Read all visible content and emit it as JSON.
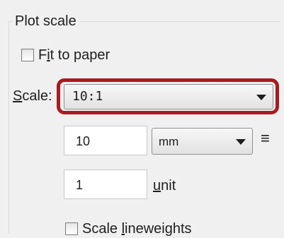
{
  "group": {
    "title": "Plot scale"
  },
  "fit_to_paper": {
    "label_pre": "F",
    "label_mnemonic": "i",
    "label_post": "t to paper",
    "checked": false
  },
  "scale": {
    "label_mnemonic": "S",
    "label_post": "cale:",
    "selected": "10:1"
  },
  "units_row": {
    "value": "10",
    "unit_selected": "mm",
    "equals": "≡"
  },
  "drawing_units_row": {
    "value": "1",
    "label_mnemonic": "u",
    "label_post": "nit"
  },
  "scale_lineweights": {
    "label_pre": "Scale ",
    "label_mnemonic": "l",
    "label_post": "ineweights",
    "checked": false
  },
  "colors": {
    "panel_bg": "#f0f0f0",
    "highlight": "#a91b1e",
    "text": "#1e1e1e"
  }
}
